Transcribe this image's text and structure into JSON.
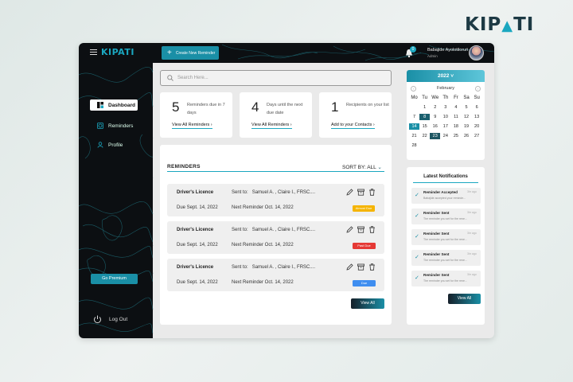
{
  "brand": {
    "pre": "KIP",
    "accent": "",
    "post": "TI",
    "full": "KIPATI"
  },
  "app_logo": "KIPATI",
  "topbar": {
    "create_button": "Create New Reminder",
    "notification_count": "0",
    "user_name": "Babajide Ayolotiloruń",
    "user_role": "Admin"
  },
  "sidebar": {
    "items": [
      {
        "label": "Dashboard",
        "icon": "dashboard-icon"
      },
      {
        "label": "Reminders",
        "icon": "alarm-icon"
      },
      {
        "label": "Profile",
        "icon": "user-icon"
      }
    ],
    "premium_button": "Go Premium",
    "logout": "Log Out"
  },
  "search": {
    "placeholder": "Search Here..."
  },
  "stats": [
    {
      "number": "5",
      "desc": "Reminders due in 7 days",
      "link": "View All Reminders"
    },
    {
      "number": "4",
      "desc": "Days until the next due date",
      "link": "View All Reminders"
    },
    {
      "number": "1",
      "desc": "Recipients on your list",
      "link": "Add to your Contacts"
    }
  ],
  "reminders": {
    "title": "REMINDERS",
    "sort_label": "SORT BY:",
    "sort_value": "ALL",
    "items": [
      {
        "name": "Driver's Licence",
        "sent_to": "Sent to:",
        "recipients": "Samuel A. , Claire I., FRSC....",
        "due": "Due Sept. 14, 2022",
        "next": "Next Reminder Oct. 14, 2022",
        "badge": "Almost Due",
        "badge_color": "#f5b400"
      },
      {
        "name": "Driver's Licence",
        "sent_to": "Sent to:",
        "recipients": "Samuel A. , Claire I., FRSC....",
        "due": "Due Sept. 14, 2022",
        "next": "Next Reminder Oct. 14, 2022",
        "badge": "Past Due",
        "badge_color": "#e53935"
      },
      {
        "name": "Driver's Licence",
        "sent_to": "Sent to:",
        "recipients": "Samuel A. , Claire I., FRSC....",
        "due": "Due Sept. 14, 2022",
        "next": "Next Reminder Oct. 14, 2022",
        "badge": "Due",
        "badge_color": "#3f8ef0"
      }
    ],
    "view_all": "View All"
  },
  "calendar": {
    "year": "2022",
    "month": "February",
    "weekdays": [
      "Mo",
      "Tu",
      "We",
      "Th",
      "Fr",
      "Sa",
      "Su"
    ],
    "days": [
      "",
      "1",
      "2",
      "3",
      "4",
      "5",
      "6",
      "7",
      "8",
      "9",
      "10",
      "11",
      "12",
      "13",
      "14",
      "15",
      "16",
      "17",
      "18",
      "19",
      "20",
      "21",
      "22",
      "23",
      "24",
      "25",
      "26",
      "27",
      "28"
    ],
    "highlighted": {
      "8": "hl1",
      "14": "hl2",
      "23": "hl3"
    }
  },
  "notifications": {
    "title": "Latest Notifications",
    "items": [
      {
        "title": "Reminder Accepted",
        "ago": "3hr ago",
        "text": "Babajide accepted your reminde..."
      },
      {
        "title": "Reminder Sent",
        "ago": "3hr ago",
        "text": "The reminder you set for the rene..."
      },
      {
        "title": "Reminder Sent",
        "ago": "3hr ago",
        "text": "The reminder you set for the rene..."
      },
      {
        "title": "Reminder Sent",
        "ago": "3hr ago",
        "text": "The reminder you set for the rene..."
      },
      {
        "title": "Reminder Sent",
        "ago": "3hr ago",
        "text": "The reminder you set for the rene..."
      }
    ],
    "view_all": "View All"
  }
}
